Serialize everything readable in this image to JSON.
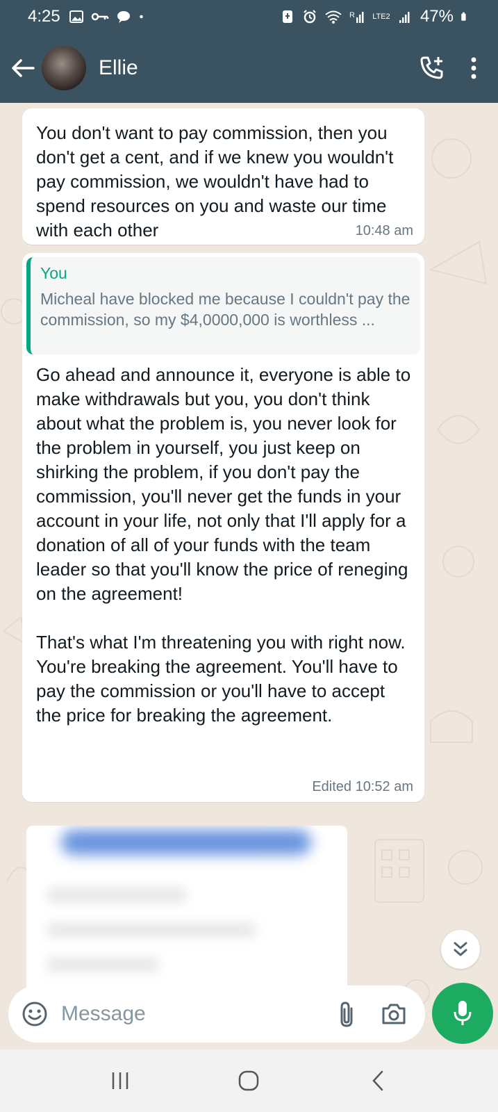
{
  "status_bar": {
    "time": "4:25",
    "battery": "47%",
    "network": "LTE2"
  },
  "header": {
    "contact_name": "Ellie"
  },
  "messages": [
    {
      "text": "You don't want to pay commission, then you don't get a cent, and if we knew you wouldn't pay commission, we wouldn't have had to spend resources on you and waste our time with each other",
      "time": "10:48 am"
    },
    {
      "quote_author": "You",
      "quote_text": "Micheal have blocked me because I couldn't pay the commission, so my $4,0000,000 is worthless ...",
      "text": "Go ahead and announce it, everyone is able to make withdrawals but you, you don't think about what the problem is, you never look for the problem in yourself, you just keep on shirking the problem, if you don't pay the commission, you'll never get the funds in your account in your life, not only that I'll apply for a donation of all of your funds with the team leader so that you'll know the price of reneging on the agreement!\n\nThat's what I'm threatening you with right now. You're breaking the agreement. You'll have to pay the commission or you'll have to accept the price for breaking the agreement.",
      "time": "Edited 10:52 am"
    }
  ],
  "input": {
    "placeholder": "Message"
  },
  "colors": {
    "header_bg": "#3b5360",
    "accent_green": "#1daa61",
    "quote_green": "#06a884",
    "chat_bg": "#efe7de"
  }
}
